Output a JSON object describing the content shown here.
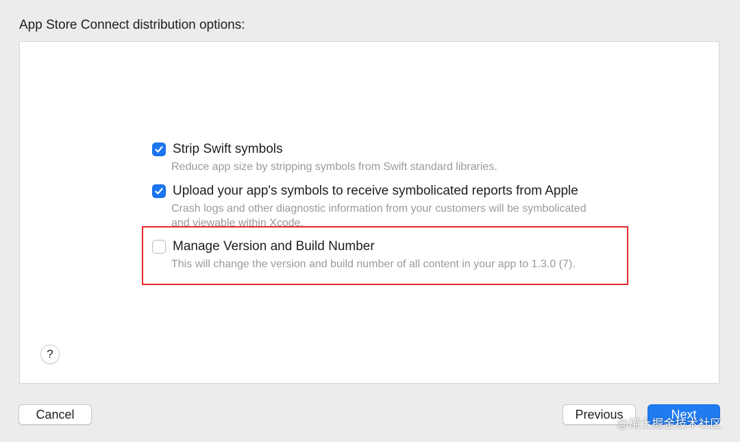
{
  "dialog": {
    "heading": "App Store Connect distribution options:"
  },
  "options": [
    {
      "label": "Strip Swift symbols",
      "description": "Reduce app size by stripping symbols from Swift standard libraries.",
      "checked": true
    },
    {
      "label": "Upload your app's symbols to receive symbolicated reports from Apple",
      "description": "Crash logs and other diagnostic information from your customers will be symbolicated and viewable within Xcode.",
      "checked": true
    },
    {
      "label": "Manage Version and Build Number",
      "description": "This will change the version and build number of all content in your app to 1.3.0 (7).",
      "checked": false
    }
  ],
  "help": {
    "glyph": "?"
  },
  "buttons": {
    "cancel": "Cancel",
    "previous": "Previous",
    "next": "Next"
  },
  "watermark": "@稀土掘金技术社区",
  "colors": {
    "accent": "#1a76f2",
    "highlight": "#e8262b",
    "description_text": "#9a9a9a"
  },
  "icons": {
    "checked": "checkmark-icon",
    "help": "help-icon"
  }
}
